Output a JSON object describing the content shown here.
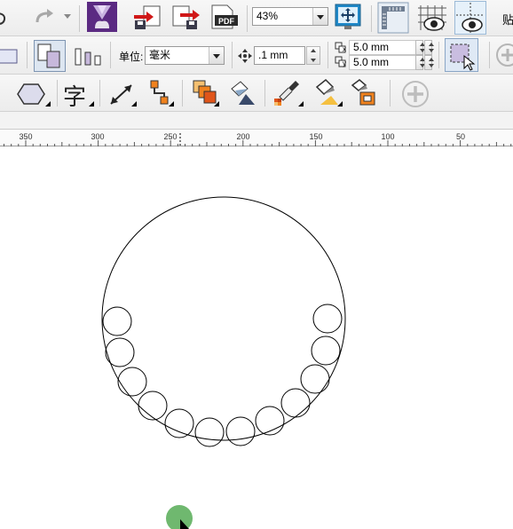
{
  "toolbar": {
    "zoom_value": "43%",
    "paste_label": "贴"
  },
  "property_bar": {
    "units_label": "单位:",
    "units_value": "毫米",
    "nudge_value": ".1 mm",
    "dup_x_label": "x",
    "dup_x_value": "5.0 mm",
    "dup_y_label": "y",
    "dup_y_value": "5.0 mm"
  },
  "toolbox": {
    "text_tool_glyph": "字"
  },
  "ruler": {
    "labels": [
      "350",
      "300",
      "250",
      "200",
      "150",
      "100",
      "50"
    ]
  },
  "colors": {
    "accent_blue": "#1e88c8",
    "orange": "#f0821e",
    "purple": "#6b2f8e",
    "cursor_green": "#5fb05f"
  },
  "icons": [
    "redo-icon",
    "launch-icon",
    "import-icon",
    "export-icon",
    "export-pdf-icon",
    "full-screen-preview-icon",
    "show-rulers-icon",
    "show-grid-icon",
    "guidelines-icon",
    "all-objects-icon",
    "align-icon",
    "text-icon",
    "dimension-icon",
    "connector-icon",
    "effects-icon",
    "transparency-icon",
    "eyedropper-icon",
    "fill-icon",
    "smart-fill-icon",
    "add-icon",
    "pick-tool-icon"
  ]
}
